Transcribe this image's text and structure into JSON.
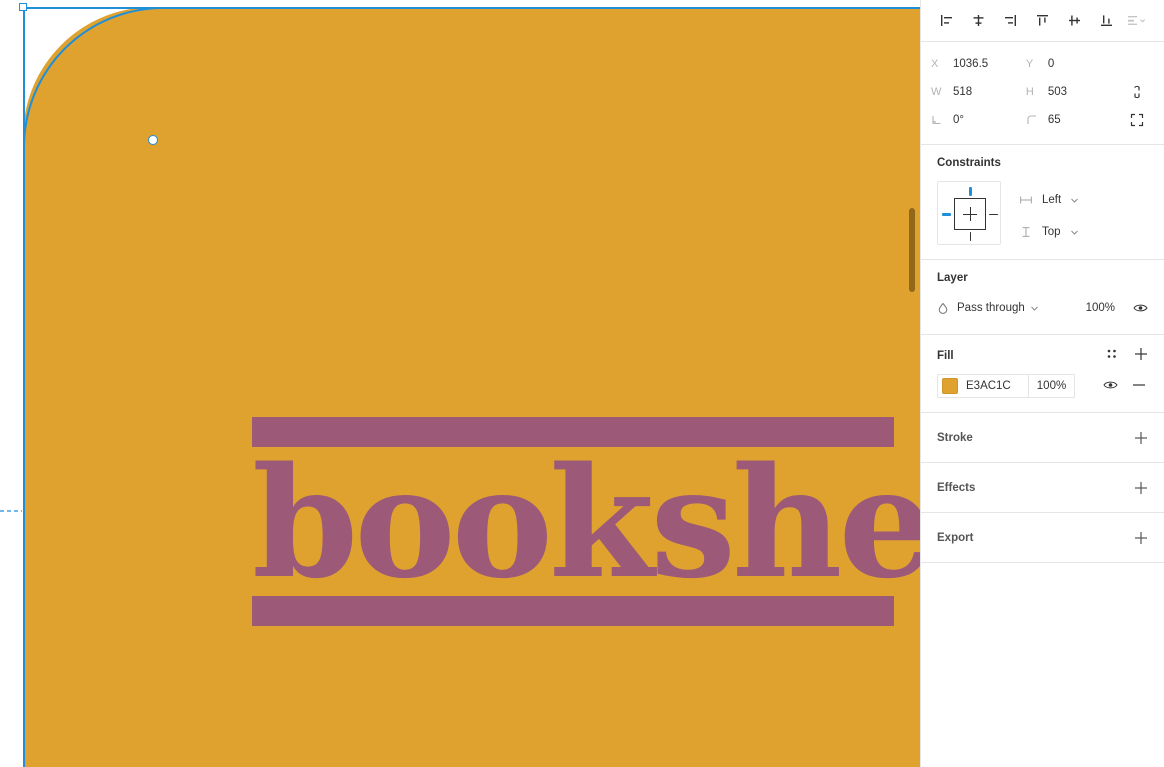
{
  "canvas": {
    "artboard_fill": "#E0A22F",
    "selection_color": "#1E8FD8",
    "guide_color": "#6FB9EC",
    "logo": {
      "wordmark": "bookshelf",
      "accent_color": "#9C5A78",
      "bar_top": "",
      "bar_bottom": ""
    }
  },
  "panel": {
    "align_toolbar": {
      "buttons": [
        {
          "name": "align-left-icon",
          "label": "Align left"
        },
        {
          "name": "align-horizontal-centers-icon",
          "label": "Align horizontal centers"
        },
        {
          "name": "align-right-icon",
          "label": "Align right"
        },
        {
          "name": "align-top-icon",
          "label": "Align top"
        },
        {
          "name": "align-vertical-centers-icon",
          "label": "Align vertical centers"
        },
        {
          "name": "align-bottom-icon",
          "label": "Align bottom"
        },
        {
          "name": "distribute-more-icon",
          "label": "More align options"
        }
      ]
    },
    "properties": {
      "x_label": "X",
      "x_value": "1036.5",
      "y_label": "Y",
      "y_value": "0",
      "w_label": "W",
      "w_value": "518",
      "h_label": "H",
      "h_value": "503",
      "rotation_value": "0°",
      "corner_radius_value": "65"
    },
    "constraints": {
      "title": "Constraints",
      "horizontal": "Left",
      "vertical": "Top"
    },
    "layer": {
      "title": "Layer",
      "blend_mode": "Pass through",
      "opacity": "100%"
    },
    "fill": {
      "title": "Fill",
      "hex": "E3AC1C",
      "opacity": "100%",
      "swatch_color": "#E0A22F"
    },
    "stroke": {
      "title": "Stroke"
    },
    "effects": {
      "title": "Effects"
    },
    "export": {
      "title": "Export"
    }
  }
}
